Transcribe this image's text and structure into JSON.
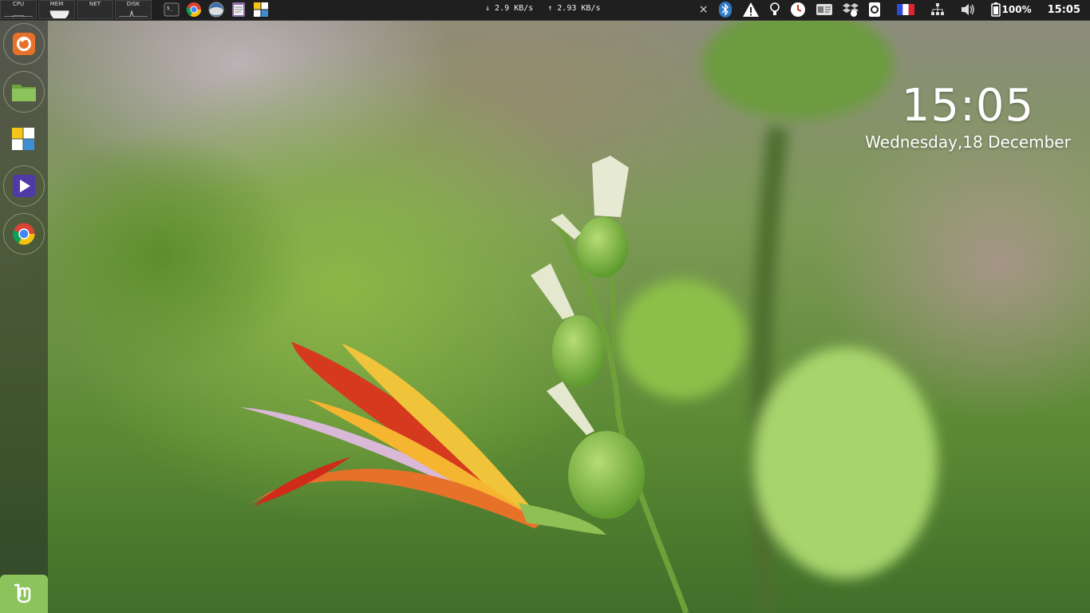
{
  "panel": {
    "monitors": [
      {
        "label": "CPU"
      },
      {
        "label": "MEM"
      },
      {
        "label": "NET"
      },
      {
        "label": "DISK"
      }
    ],
    "launchers": [
      "terminal-icon",
      "chrome-icon",
      "web-browser-icon",
      "text-editor-icon",
      "office-icon"
    ],
    "network": {
      "down": "↓ 2.9 KB/s",
      "up": "↑ 2.93 KB/s"
    },
    "tray": {
      "close": "×",
      "battery": "100%",
      "clock": "15:05"
    }
  },
  "dock": {
    "items": [
      "firefox-icon",
      "files-icon",
      "office-icon",
      "media-player-icon",
      "chrome-icon"
    ],
    "menu": "mint-menu-icon"
  },
  "desklet": {
    "time": "15:05",
    "date": "Wednesday,18 December"
  },
  "colors": {
    "panel": "#1f1f1f",
    "menu_button": "#8cc35d",
    "text": "#ffffff"
  }
}
